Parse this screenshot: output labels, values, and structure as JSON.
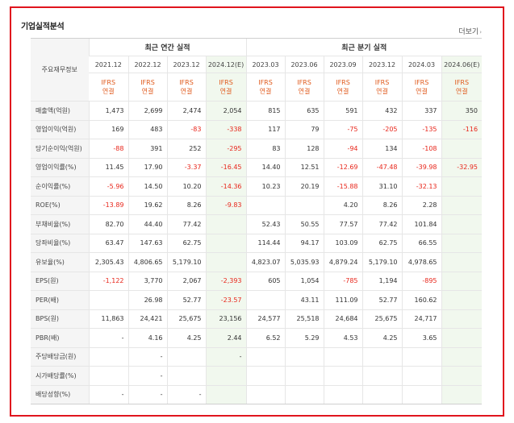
{
  "title": "기업실적분석",
  "more_label": "더보기",
  "row_header_label": "주요재무정보",
  "groups": {
    "annual": "최근 연간 실적",
    "quarterly": "최근 분기 실적"
  },
  "periods": [
    "2021.12",
    "2022.12",
    "2023.12",
    "2024.12(E)",
    "2023.03",
    "2023.06",
    "2023.09",
    "2023.12",
    "2024.03",
    "2024.06(E)"
  ],
  "ifrs": {
    "line1": "IFRS",
    "line2": "연결"
  },
  "colors": {
    "negative": "#e8261b",
    "ifrs": "#e05a1c",
    "estimate_bg": "#f1f8ee",
    "frame": "#e0141e"
  },
  "rows": [
    {
      "label": "매출액(억원)",
      "values": [
        "1,473",
        "2,699",
        "2,474",
        "2,054",
        "815",
        "635",
        "591",
        "432",
        "337",
        "350"
      ]
    },
    {
      "label": "영업이익(억원)",
      "values": [
        "169",
        "483",
        "-83",
        "-338",
        "117",
        "79",
        "-75",
        "-205",
        "-135",
        "-116"
      ]
    },
    {
      "label": "당기순이익(억원)",
      "values": [
        "-88",
        "391",
        "252",
        "-295",
        "83",
        "128",
        "-94",
        "134",
        "-108",
        ""
      ]
    },
    {
      "label": "영업이익률(%)",
      "values": [
        "11.45",
        "17.90",
        "-3.37",
        "-16.45",
        "14.40",
        "12.51",
        "-12.69",
        "-47.48",
        "-39.98",
        "-32.95"
      ]
    },
    {
      "label": "순이익률(%)",
      "values": [
        "-5.96",
        "14.50",
        "10.20",
        "-14.36",
        "10.23",
        "20.19",
        "-15.88",
        "31.10",
        "-32.13",
        ""
      ]
    },
    {
      "label": "ROE(%)",
      "values": [
        "-13.89",
        "19.62",
        "8.26",
        "-9.83",
        "",
        "",
        "4.20",
        "8.26",
        "2.28",
        ""
      ]
    },
    {
      "label": "부채비율(%)",
      "values": [
        "82.70",
        "44.40",
        "77.42",
        "",
        "52.43",
        "50.55",
        "77.57",
        "77.42",
        "101.84",
        ""
      ]
    },
    {
      "label": "당좌비율(%)",
      "values": [
        "63.47",
        "147.63",
        "62.75",
        "",
        "114.44",
        "94.17",
        "103.09",
        "62.75",
        "66.55",
        ""
      ]
    },
    {
      "label": "유보율(%)",
      "values": [
        "2,305.43",
        "4,806.65",
        "5,179.10",
        "",
        "4,823.07",
        "5,035.93",
        "4,879.24",
        "5,179.10",
        "4,978.65",
        ""
      ]
    },
    {
      "label": "EPS(원)",
      "values": [
        "-1,122",
        "3,770",
        "2,067",
        "-2,393",
        "605",
        "1,054",
        "-785",
        "1,194",
        "-895",
        ""
      ]
    },
    {
      "label": "PER(배)",
      "values": [
        "",
        "26.98",
        "52.77",
        "-23.57",
        "",
        "43.11",
        "111.09",
        "52.77",
        "160.62",
        ""
      ]
    },
    {
      "label": "BPS(원)",
      "values": [
        "11,863",
        "24,421",
        "25,675",
        "23,156",
        "24,577",
        "25,518",
        "24,684",
        "25,675",
        "24,717",
        ""
      ]
    },
    {
      "label": "PBR(배)",
      "values": [
        "-",
        "4.16",
        "4.25",
        "2.44",
        "6.52",
        "5.29",
        "4.53",
        "4.25",
        "3.65",
        ""
      ]
    },
    {
      "label": "주당배당금(원)",
      "values": [
        "",
        "-",
        "",
        "-",
        "",
        "",
        "",
        "",
        "",
        ""
      ]
    },
    {
      "label": "시가배당률(%)",
      "values": [
        "",
        "-",
        "",
        "",
        "",
        "",
        "",
        "",
        "",
        ""
      ]
    },
    {
      "label": "배당성향(%)",
      "values": [
        "-",
        "-",
        "-",
        "",
        "",
        "",
        "",
        "",
        "",
        ""
      ]
    }
  ]
}
